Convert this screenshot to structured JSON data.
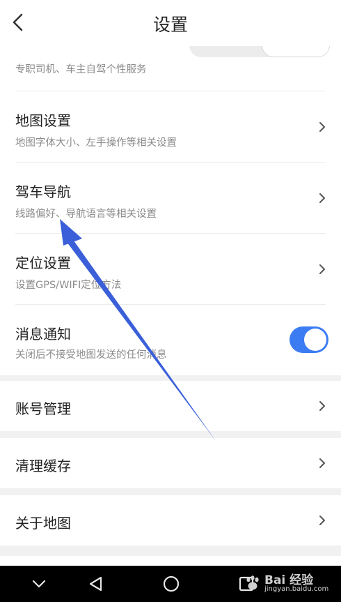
{
  "header": {
    "title": "设置"
  },
  "rows": {
    "partial_sub": "专职司机、车主自驾个性服务",
    "map_settings": {
      "label": "地图设置",
      "sub": "地图字体大小、左手操作等相关设置"
    },
    "driving_nav": {
      "label": "驾车导航",
      "sub": "线路偏好、导航语言等相关设置"
    },
    "location": {
      "label": "定位设置",
      "sub": "设置GPS/WIFI定位方法"
    },
    "notifications": {
      "label": "消息通知",
      "sub": "关闭后不接受地图发送的任何消息",
      "enabled": true
    },
    "account": {
      "label": "账号管理"
    },
    "cache": {
      "label": "清理缓存"
    },
    "about": {
      "label": "关于地图"
    }
  },
  "watermark": {
    "brand": "Bai 经验",
    "url": "jingyan.baidu.com"
  },
  "colors": {
    "accent": "#3b7cf3",
    "annotation": "#3a5fd9",
    "separator": "#f1f1f1"
  },
  "icons": [
    "back-arrow-icon",
    "chevron-right-icon",
    "nav-down-icon",
    "nav-back-icon",
    "nav-home-icon",
    "nav-recent-icon",
    "baidu-paw-icon"
  ]
}
